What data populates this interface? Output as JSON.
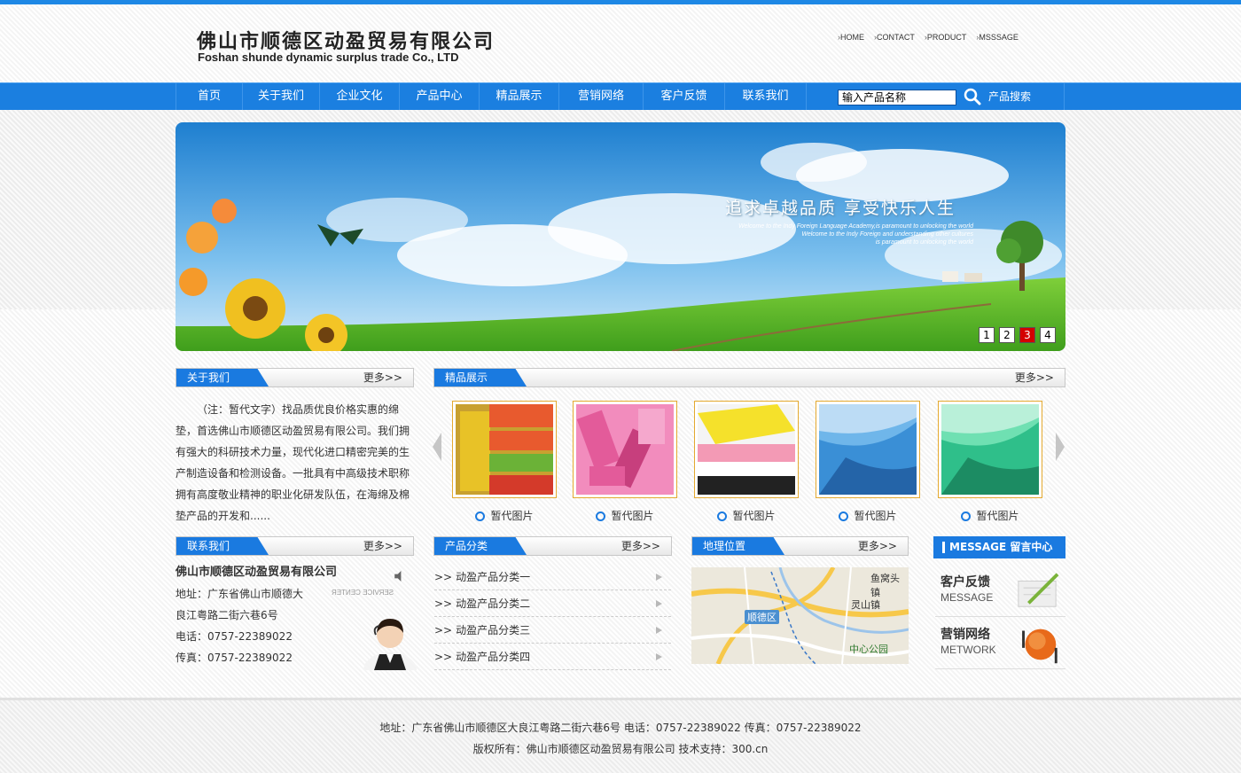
{
  "header": {
    "logo_cn": "佛山市顺德区动盈贸易有限公司",
    "logo_en": "Foshan shunde dynamic surplus trade Co., LTD",
    "top_links": [
      "HOME",
      "CONTACT",
      "PRODUCT",
      "MSSSAGE"
    ]
  },
  "nav": {
    "items": [
      "首页",
      "关于我们",
      "企业文化",
      "产品中心",
      "精品展示",
      "营销网络",
      "客户反馈",
      "联系我们"
    ],
    "search_value": "输入产品名称",
    "search_label": "产品搜索"
  },
  "banner": {
    "slogan": "追求卓越品质   享受快乐人生",
    "sub_lines": [
      "Welcome to the Indy Foreign Language Academy,is paramount to unlocking the world",
      "Welcome to the Indy Foreign and understanding other cultures",
      "is paramount to unlocking the world"
    ],
    "pager": [
      "1",
      "2",
      "3",
      "4"
    ],
    "pager_active": "3"
  },
  "about": {
    "title": "关于我们",
    "more": "更多>>",
    "text": "（注：暂代文字）找品质优良价格实惠的绵垫，首选佛山市顺德区动盈贸易有限公司。我们拥有强大的科研技术力量，现代化进口精密完美的生产制造设备和检测设备。一批具有中高级技术职称拥有高度敬业精神的职业化研发队伍，在海绵及棉垫产品的开发和......"
  },
  "showcase": {
    "title": "精品展示",
    "more": "更多>>",
    "items": [
      {
        "caption": "暂代图片",
        "colors": [
          "#e8c227",
          "#e85a2e",
          "#6bb237",
          "#d43a2a"
        ]
      },
      {
        "caption": "暂代图片",
        "colors": [
          "#e35b9a",
          "#f28cbd",
          "#c73f7d",
          "#f5a8cd"
        ]
      },
      {
        "caption": "暂代图片",
        "colors": [
          "#f5e12b",
          "#f39ab5",
          "#ffffff",
          "#222222"
        ]
      },
      {
        "caption": "暂代图片",
        "colors": [
          "#3a8fd6",
          "#6fb6ea",
          "#2464a8",
          "#bcdcf5"
        ]
      },
      {
        "caption": "暂代图片",
        "colors": [
          "#2fbf8a",
          "#6fe0b2",
          "#1c8c63",
          "#b9f0d9"
        ]
      }
    ]
  },
  "contact": {
    "title": "联系我们",
    "more": "更多>>",
    "company": "佛山市顺德区动盈贸易有限公司",
    "address1": "地址：广东省佛山市顺德大",
    "address2": "良江粤路二街六巷6号",
    "phone": "电话：0757-22389022",
    "fax": "传真：0757-22389022",
    "service": "SERVICE CENTER"
  },
  "categories": {
    "title": "产品分类",
    "more": "更多>>",
    "items": [
      "动盈产品分类一",
      "动盈产品分类二",
      "动盈产品分类三",
      "动盈产品分类四"
    ]
  },
  "location": {
    "title": "地理位置",
    "more": "更多>>",
    "labels": [
      "鱼窝头镇",
      "灵山镇",
      "顺德区",
      "中心公园"
    ]
  },
  "message": {
    "title": "MESSAGE 留言中心",
    "boxes": [
      {
        "cn": "客户反馈",
        "en": "MESSAGE"
      },
      {
        "cn": "营销网络",
        "en": "METWORK"
      }
    ]
  },
  "footer": {
    "line1": "地址：广东省佛山市顺德区大良江粤路二街六巷6号    电话：0757-22389022   传真：0757-22389022",
    "line2": "版权所有：佛山市顺德区动盈贸易有限公司   技术支持：300.cn"
  },
  "colors": {
    "accent": "#1a7ae0",
    "frame": "#e4a92f",
    "pager_active": "#d40000"
  }
}
